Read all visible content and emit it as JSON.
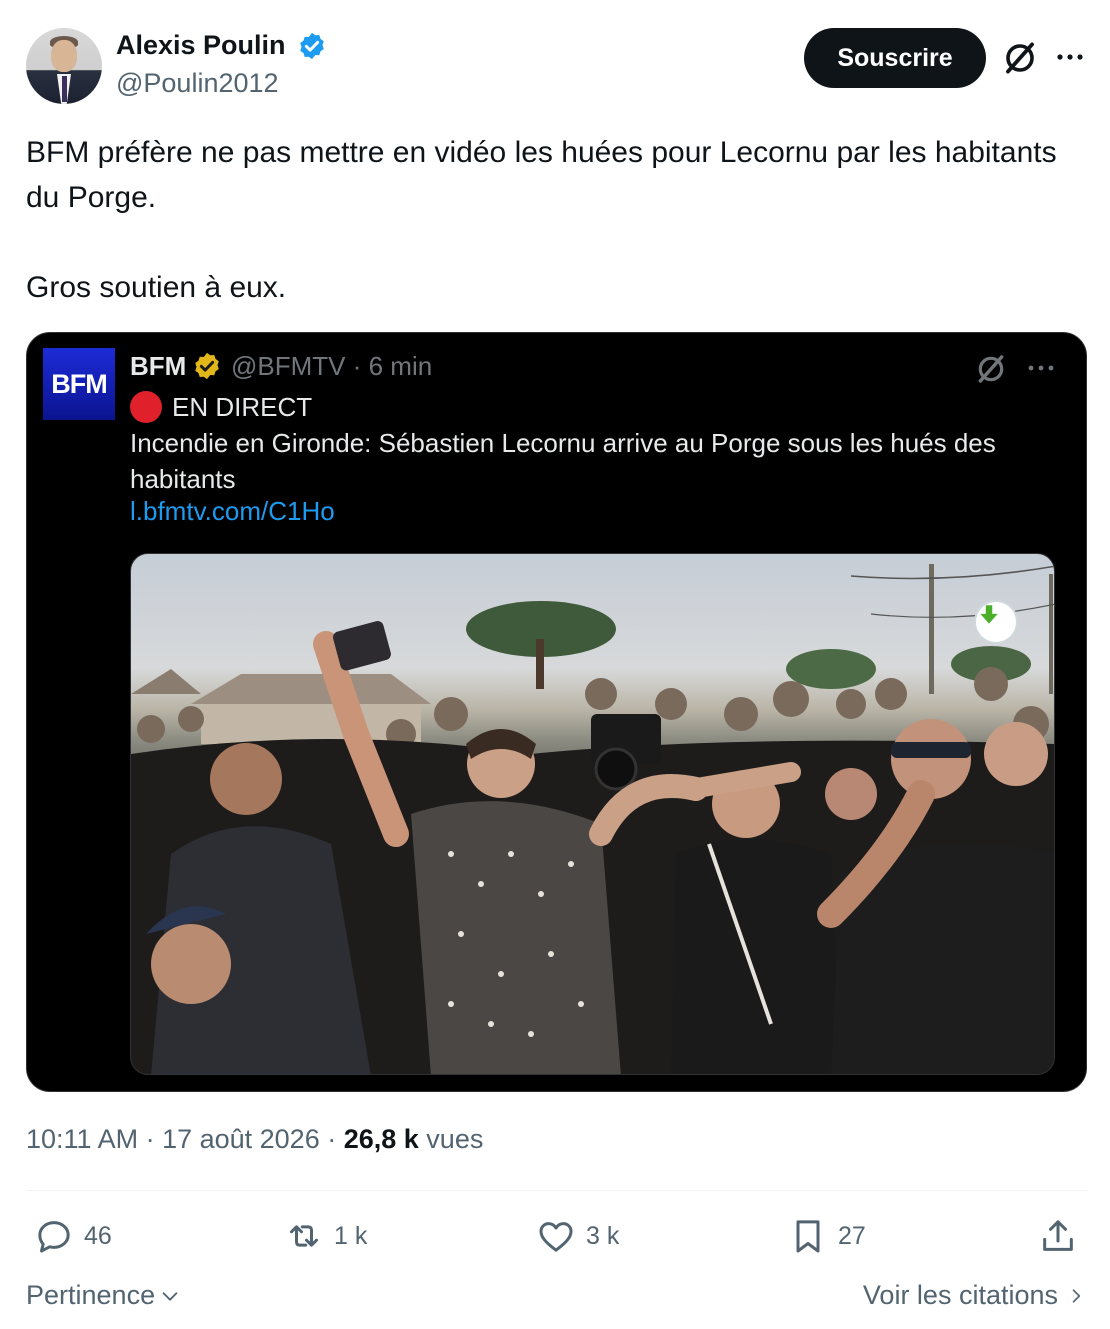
{
  "author": {
    "name": "Alexis Poulin",
    "handle": "@Poulin2012",
    "avatar_icon": "person-avatar"
  },
  "header": {
    "subscribe_label": "Souscrire"
  },
  "tweet": {
    "text": "BFM préfère ne pas mettre en vidéo les huées pour Lecornu par les habitants du Porge.\n\nGros soutien à eux."
  },
  "quote": {
    "logo_text": "BFM",
    "name": "BFM",
    "handle_time": "@BFMTV · 6 min",
    "live_label": "EN DIRECT",
    "text": "Incendie en Gironde: Sébastien Lecornu arrive au Porge sous les hués des habitants",
    "link": "l.bfmtv.com/C1Ho"
  },
  "meta": {
    "time_date": "10:11 AM · 17 août 2026 · ",
    "views_count": "26,8 k",
    "views_label": " vues"
  },
  "actions": {
    "replies": "46",
    "reposts": "1 k",
    "likes": "3 k",
    "bookmarks": "27"
  },
  "footer": {
    "sort_label": "Pertinence",
    "quotes_label": "Voir les citations"
  },
  "colors": {
    "accent": "#1d9bf0",
    "text_primary": "#0f1419",
    "text_secondary": "#536471",
    "verified_blue": "#1d9bf0",
    "verified_gold": "#e2b719",
    "live_red": "#e0202a"
  }
}
